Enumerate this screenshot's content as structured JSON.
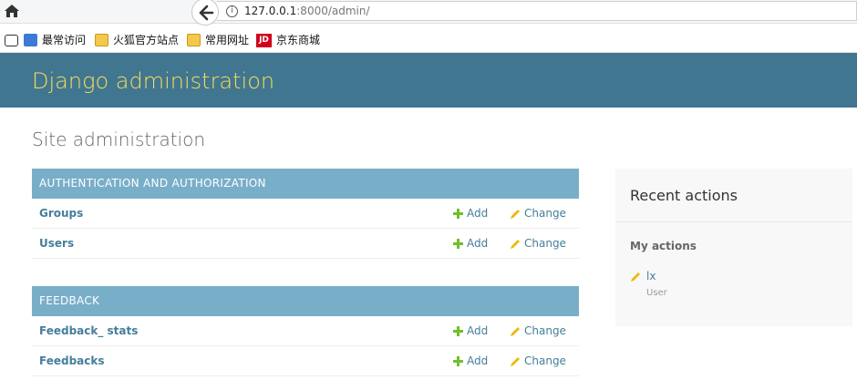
{
  "browser": {
    "url_host": "127.0.0.1",
    "url_rest": ":8000/admin/",
    "bookmarks": [
      {
        "label": "最常访问",
        "icon": "recent-icon"
      },
      {
        "label": "火狐官方站点",
        "icon": "folder-icon"
      },
      {
        "label": "常用网址",
        "icon": "folder-icon"
      },
      {
        "label": "京东商城",
        "icon": "jd-icon"
      }
    ],
    "jd_icon_text": "JD"
  },
  "header": {
    "branding": "Django administration",
    "brand_color": "#f5dd5d",
    "bg_color": "#417690"
  },
  "page": {
    "title": "Site administration"
  },
  "apps": [
    {
      "caption": "AUTHENTICATION AND AUTHORIZATION",
      "models": [
        {
          "name": "Groups",
          "add": "Add",
          "change": "Change"
        },
        {
          "name": "Users",
          "add": "Add",
          "change": "Change"
        }
      ]
    },
    {
      "caption": "FEEDBACK",
      "models": [
        {
          "name": "Feedback_ stats",
          "add": "Add",
          "change": "Change"
        },
        {
          "name": "Feedbacks",
          "add": "Add",
          "change": "Change"
        }
      ]
    }
  ],
  "recent": {
    "title": "Recent actions",
    "subtitle": "My actions",
    "items": [
      {
        "name": "lx",
        "type": "User",
        "icon": "pencil-icon"
      }
    ]
  }
}
